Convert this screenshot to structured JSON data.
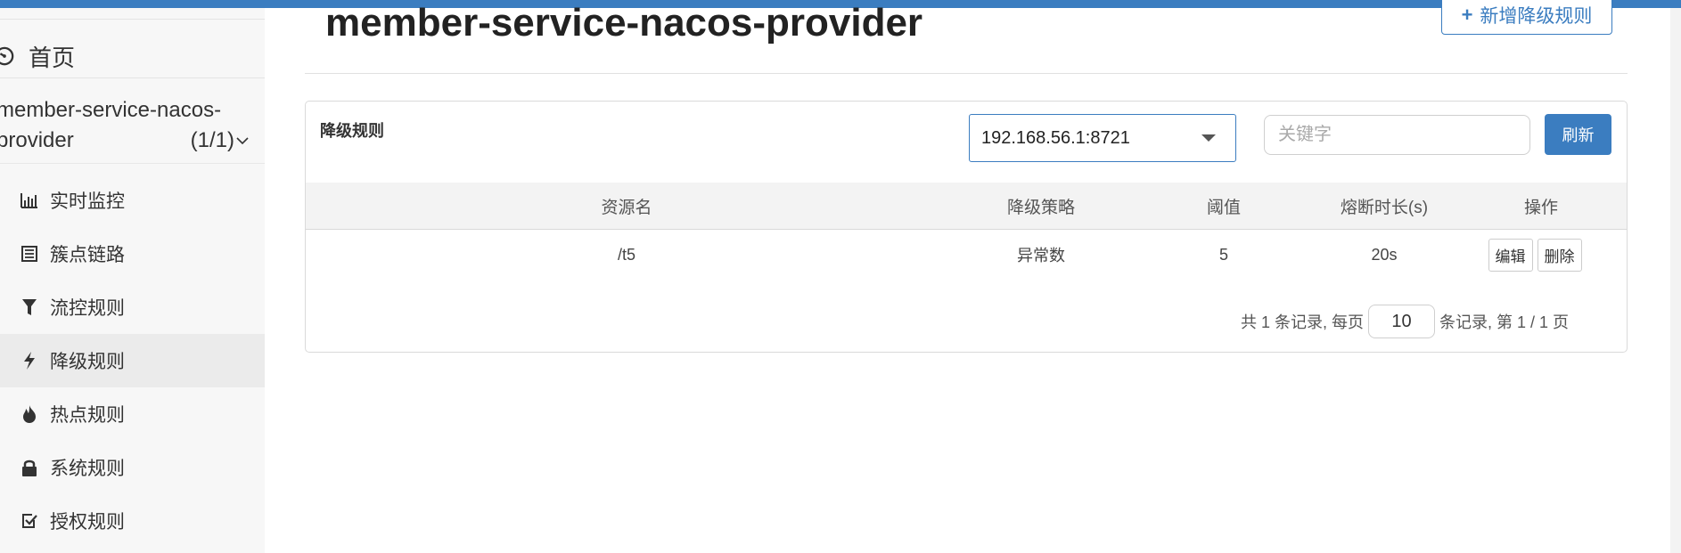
{
  "sidebar": {
    "home_label": "首页",
    "app": {
      "name_line1": "member-service-nacos-",
      "name_line2": "provider",
      "count": "(1/1)"
    },
    "items": [
      {
        "label": "实时监控",
        "icon": "bar-chart-icon"
      },
      {
        "label": "簇点链路",
        "icon": "list-icon"
      },
      {
        "label": "流控规则",
        "icon": "filter-icon"
      },
      {
        "label": "降级规则",
        "icon": "flash-icon",
        "active": true
      },
      {
        "label": "热点规则",
        "icon": "fire-icon"
      },
      {
        "label": "系统规则",
        "icon": "lock-icon"
      },
      {
        "label": "授权规则",
        "icon": "check-square-icon"
      }
    ]
  },
  "header": {
    "title": "member-service-nacos-provider",
    "add_button": "新增降级规则"
  },
  "panel": {
    "title": "降级规则",
    "machine": "192.168.56.1:8721",
    "search_placeholder": "关键字",
    "refresh": "刷新"
  },
  "table": {
    "columns": [
      "资源名",
      "降级策略",
      "阈值",
      "熔断时长(s)",
      "操作"
    ],
    "rows": [
      {
        "resource": "/t5",
        "strategy": "异常数",
        "threshold": "5",
        "duration": "20s",
        "edit": "编辑",
        "delete": "删除"
      }
    ]
  },
  "pagination": {
    "prefix": "共 1 条记录, 每页",
    "page_size": "10",
    "suffix": "条记录, 第 1 / 1 页"
  },
  "colors": {
    "primary": "#3b7dc0",
    "sidebar_bg": "#f7f7f7",
    "active_bg": "#ebebeb"
  }
}
